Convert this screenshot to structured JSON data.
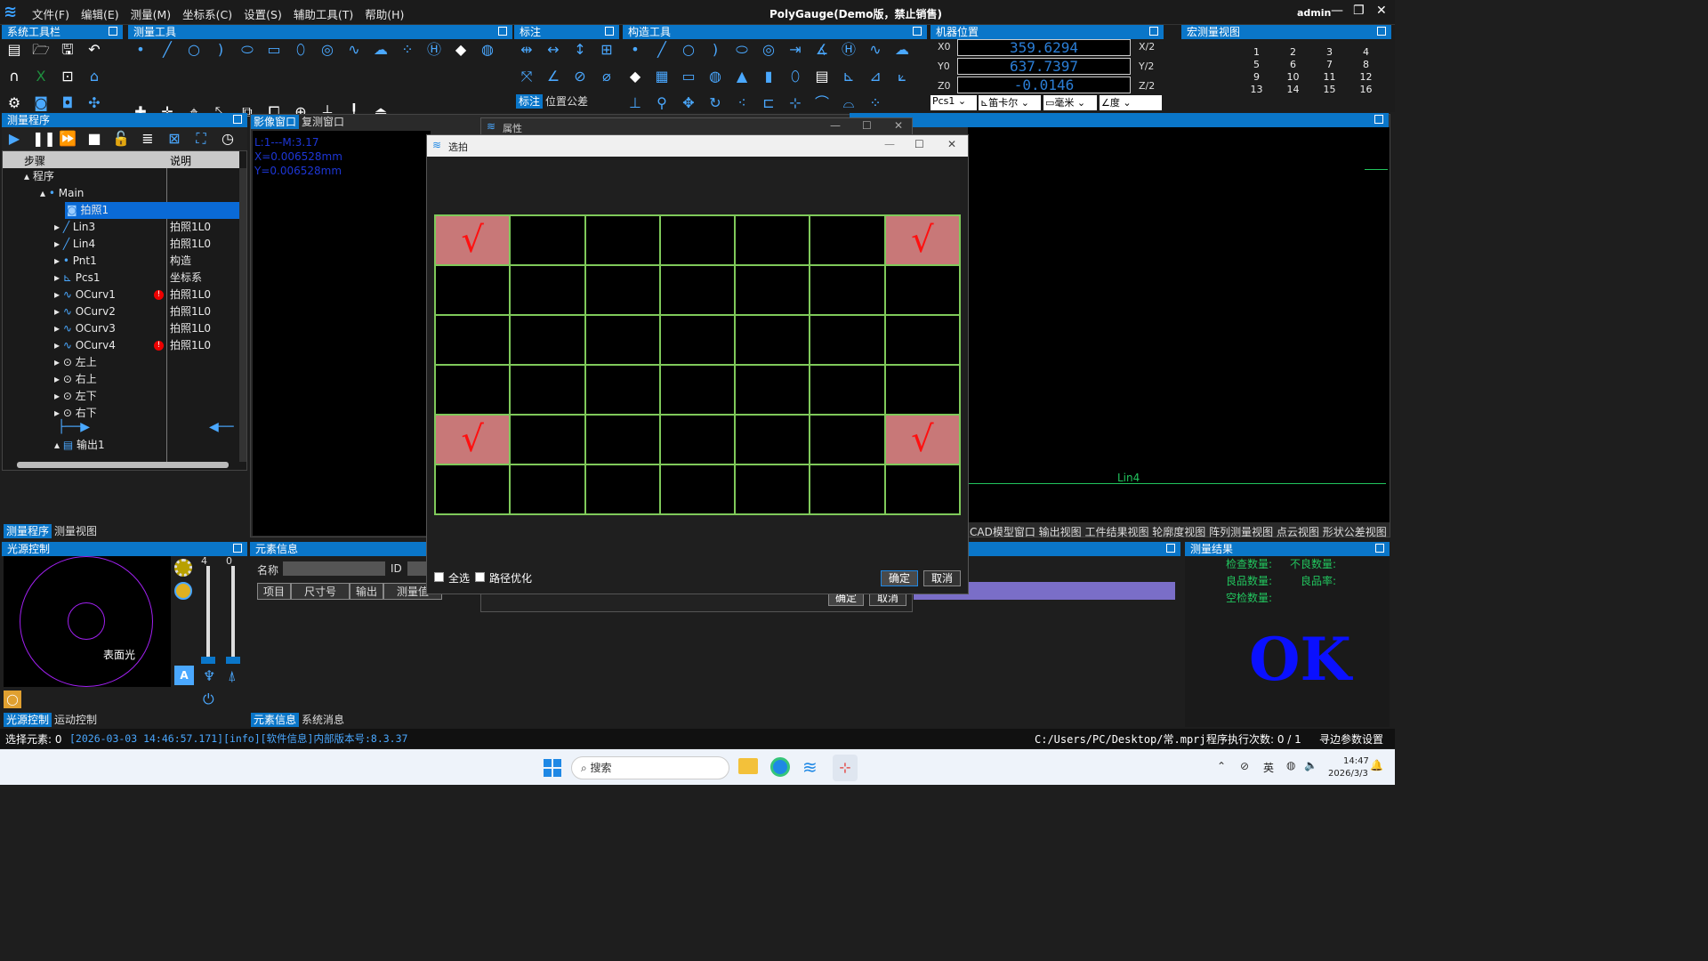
{
  "menu": [
    "文件(F)",
    "编辑(E)",
    "测量(M)",
    "坐标系(C)",
    "设置(S)",
    "辅助工具(T)",
    "帮助(H)"
  ],
  "app_title": "PolyGauge(Demo版，禁止销售)",
  "user": "admin",
  "panels": {
    "system_toolbar": "系统工具栏",
    "measure_tools": "测量工具",
    "annotate": "标注",
    "construct_tools": "构造工具",
    "machine_pos": "机器位置",
    "macro_view": "宏测量视图",
    "measure_program": "测量程序",
    "light_control": "光源控制",
    "element_info": "元素信息",
    "measure_result": "测量结果"
  },
  "annotate_tabs": [
    "标注",
    "位置公差"
  ],
  "machine": {
    "x_label": "X0",
    "y_label": "Y0",
    "z_label": "Z0",
    "x": "359.6294",
    "y": "637.7397",
    "z": "-0.0146",
    "x_half": "X/2",
    "y_half": "Y/2",
    "z_half": "Z/2",
    "coord": "Pcs1",
    "coord_type": "笛卡尔",
    "unit": "毫米",
    "angle": "度"
  },
  "macro_numbers": [
    "1",
    "2",
    "3",
    "4",
    "5",
    "6",
    "7",
    "8",
    "9",
    "10",
    "11",
    "12",
    "13",
    "14",
    "15",
    "16"
  ],
  "tree": {
    "col_step": "步骤",
    "col_desc": "说明",
    "rows": [
      {
        "name": "程序",
        "desc": ""
      },
      {
        "name": "Main",
        "desc": ""
      },
      {
        "name": "拍照1",
        "desc": ""
      },
      {
        "name": "Lin3",
        "desc": "拍照1L0"
      },
      {
        "name": "Lin4",
        "desc": "拍照1L0"
      },
      {
        "name": "Pnt1",
        "desc": "构造"
      },
      {
        "name": "Pcs1",
        "desc": "坐标系"
      },
      {
        "name": "OCurv1",
        "desc": "拍照1L0"
      },
      {
        "name": "OCurv2",
        "desc": "拍照1L0"
      },
      {
        "name": "OCurv3",
        "desc": "拍照1L0"
      },
      {
        "name": "OCurv4",
        "desc": "拍照1L0"
      },
      {
        "name": "左上",
        "desc": ""
      },
      {
        "name": "右上",
        "desc": ""
      },
      {
        "name": "左下",
        "desc": ""
      },
      {
        "name": "右下",
        "desc": ""
      },
      {
        "name": "输出1",
        "desc": ""
      }
    ]
  },
  "bottom_tabs_left": [
    "测量程序",
    "测量视图"
  ],
  "image_tabs": [
    "影像窗口",
    "复测窗口"
  ],
  "overlay": {
    "l1": "L:1---M:3.17",
    "x": "X=0.006528mm",
    "y": "Y=0.006528mm"
  },
  "light": {
    "label": "表面光",
    "val1": "4",
    "val2": "0",
    "mode": "A"
  },
  "light_tabs": [
    "光源控制",
    "运动控制"
  ],
  "element": {
    "name_label": "名称",
    "id_label": "ID",
    "cols": [
      "项目",
      "尺寸号",
      "输出",
      "测量值"
    ]
  },
  "element_tabs": [
    "元素信息",
    "系统消息"
  ],
  "view_tabs": "CAD模型窗口 输出视图 工件结果视图 轮廓度视图 阵列测量视图 点云视图 形状公差视图",
  "result": {
    "inspect": "检查数量:",
    "bad": "不良数量:",
    "good": "良品数量:",
    "rate": "良品率:",
    "empty": "空检数量:",
    "ok": "OK"
  },
  "lin4_label": "Lin4",
  "props_dialog": {
    "title": "属性",
    "ok": "确定",
    "cancel": "取消"
  },
  "dialog": {
    "title": "选拍",
    "select_all": "全选",
    "path_opt": "路径优化",
    "ok": "确定",
    "cancel": "取消",
    "grid": [
      [
        true,
        false,
        false,
        false,
        false,
        false,
        true
      ],
      [
        false,
        false,
        false,
        false,
        false,
        false,
        false
      ],
      [
        false,
        false,
        false,
        false,
        false,
        false,
        false
      ],
      [
        false,
        false,
        false,
        false,
        false,
        false,
        false
      ],
      [
        true,
        false,
        false,
        false,
        false,
        false,
        true
      ],
      [
        false,
        false,
        false,
        false,
        false,
        false,
        false
      ]
    ],
    "check_glyph": "√"
  },
  "status": {
    "select": "选择元素: 0",
    "log": "[2026-03-03 14:46:57.171][info][软件信息]内部版本号:8.3.37",
    "path": "C:/Users/PC/Desktop/常.mprj",
    "exec": "程序执行次数: 0 / 1",
    "edge": "寻边参数设置"
  },
  "taskbar": {
    "search": "搜索",
    "lang": "英",
    "time": "14:47",
    "date": "2026/3/3"
  }
}
